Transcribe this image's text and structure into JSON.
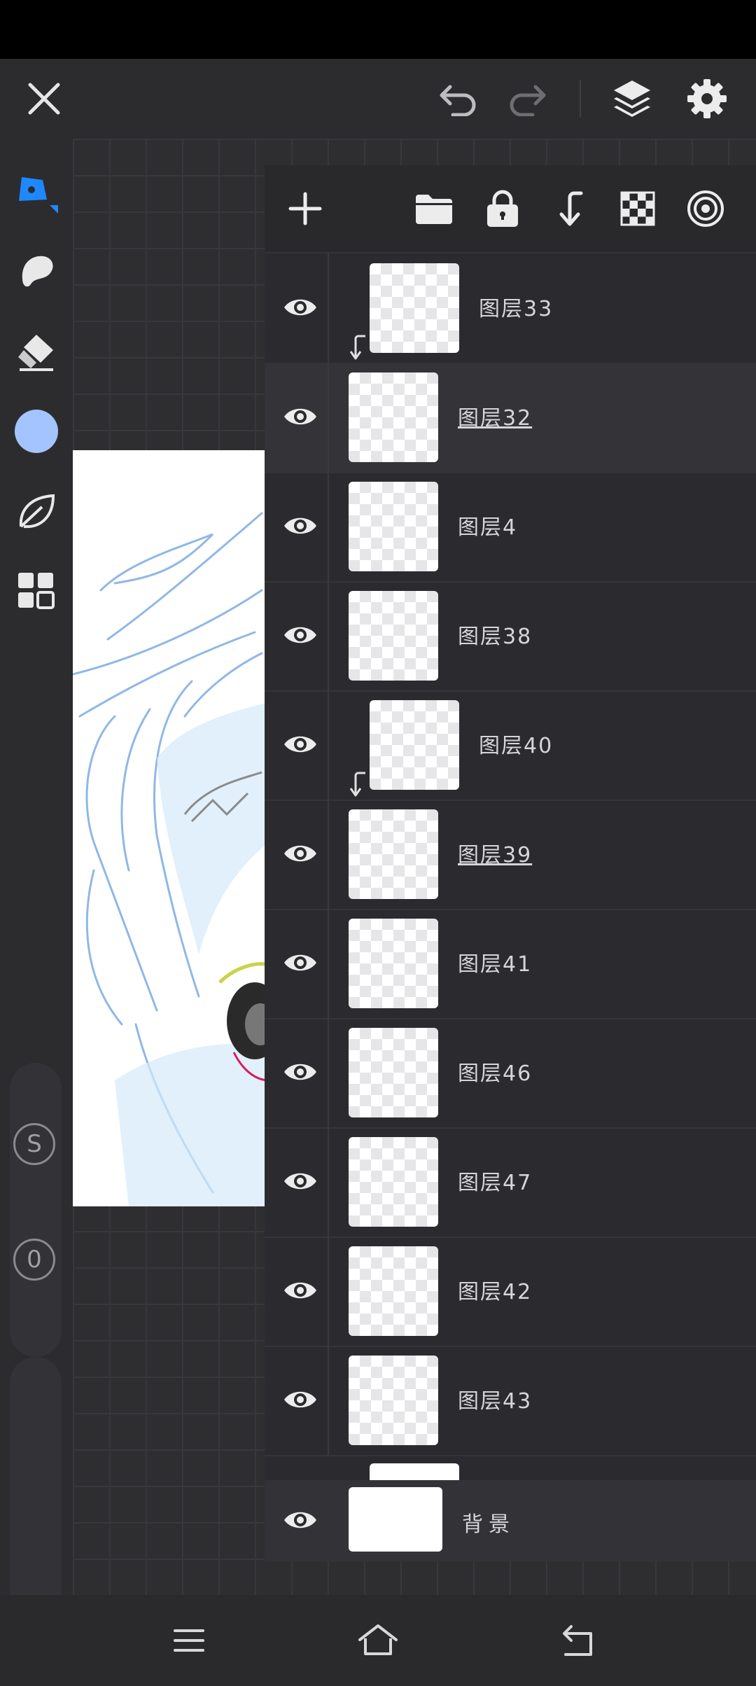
{
  "app": {
    "top_toolbar": {
      "icons": [
        "close-icon",
        "undo-icon",
        "redo-icon",
        "layers-icon",
        "settings-icon"
      ]
    },
    "left_toolbar": {
      "tools": [
        "pen-icon",
        "smudge-icon",
        "eraser-icon",
        "color-swatch",
        "leaf-brush-icon",
        "grid-icon"
      ],
      "current_color": "#a4c4ff",
      "accent_color": "#1e88ff",
      "size_badge": "S",
      "opacity_badge": "0"
    },
    "layer_panel": {
      "toolbar_icons": [
        "add-layer-icon",
        "folder-icon",
        "lock-icon",
        "merge-down-icon",
        "checker-icon",
        "target-icon"
      ],
      "layers": [
        {
          "name": "图层33",
          "clipped": true,
          "underlined": false,
          "selected": false
        },
        {
          "name": "图层32",
          "clipped": false,
          "underlined": true,
          "selected": true
        },
        {
          "name": "图层4",
          "clipped": false,
          "underlined": false,
          "selected": false
        },
        {
          "name": "图层38",
          "clipped": false,
          "underlined": false,
          "selected": false
        },
        {
          "name": "图层40",
          "clipped": true,
          "underlined": false,
          "selected": false
        },
        {
          "name": "图层39",
          "clipped": false,
          "underlined": true,
          "selected": false
        },
        {
          "name": "图层41",
          "clipped": false,
          "underlined": false,
          "selected": false
        },
        {
          "name": "图层46",
          "clipped": false,
          "underlined": false,
          "selected": false
        },
        {
          "name": "图层47",
          "clipped": false,
          "underlined": false,
          "selected": false
        },
        {
          "name": "图层42",
          "clipped": false,
          "underlined": false,
          "selected": false
        },
        {
          "name": "图层43",
          "clipped": false,
          "underlined": false,
          "selected": false
        }
      ],
      "background_layer": {
        "name": "背景"
      }
    },
    "navbar": {
      "icons": [
        "menu-icon",
        "home-icon",
        "back-icon"
      ]
    }
  }
}
